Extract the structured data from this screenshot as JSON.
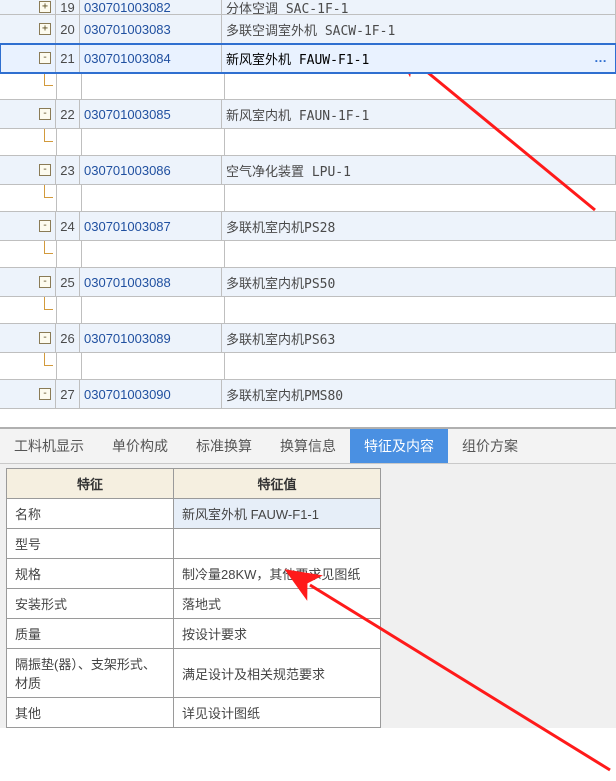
{
  "tree": {
    "rows": [
      {
        "exp": "+",
        "idx": "19",
        "code": "030701003082",
        "desc": "分体空调 SAC-1F-1",
        "spacer_after": false
      },
      {
        "exp": "+",
        "idx": "20",
        "code": "030701003083",
        "desc": "多联空调室外机 SACW-1F-1",
        "spacer_after": false
      },
      {
        "exp": "-",
        "idx": "21",
        "code": "030701003084",
        "desc": "新风室外机 FAUW-F1-1",
        "spacer_after": true,
        "selected": true,
        "ellipsis": "…"
      },
      {
        "exp": "-",
        "idx": "22",
        "code": "030701003085",
        "desc": "新风室内机 FAUN-1F-1",
        "spacer_after": true
      },
      {
        "exp": "-",
        "idx": "23",
        "code": "030701003086",
        "desc": "空气净化装置 LPU-1",
        "spacer_after": true
      },
      {
        "exp": "-",
        "idx": "24",
        "code": "030701003087",
        "desc": "多联机室内机PS28",
        "spacer_after": true
      },
      {
        "exp": "-",
        "idx": "25",
        "code": "030701003088",
        "desc": "多联机室内机PS50",
        "spacer_after": true
      },
      {
        "exp": "-",
        "idx": "26",
        "code": "030701003089",
        "desc": "多联机室内机PS63",
        "spacer_after": true
      },
      {
        "exp": "-",
        "idx": "27",
        "code": "030701003090",
        "desc": "多联机室内机PMS80",
        "spacer_after": false
      }
    ]
  },
  "panel": {
    "tabs": [
      {
        "label": "工料机显示"
      },
      {
        "label": "单价构成"
      },
      {
        "label": "标准换算"
      },
      {
        "label": "换算信息"
      },
      {
        "label": "特征及内容",
        "active": true
      },
      {
        "label": "组价方案"
      }
    ],
    "header": {
      "col1": "特征",
      "col2": "特征值"
    },
    "props": [
      {
        "key": "名称",
        "val": "新风室外机 FAUW-F1-1",
        "hi": true
      },
      {
        "key": "型号",
        "val": ""
      },
      {
        "key": "规格",
        "val": "制冷量28KW，其他要求见图纸"
      },
      {
        "key": "安装形式",
        "val": "落地式"
      },
      {
        "key": "质量",
        "val": "按设计要求"
      },
      {
        "key": "隔振垫(器）、支架形式、材质",
        "val": "满足设计及相关规范要求"
      },
      {
        "key": "其他",
        "val": "详见设计图纸"
      }
    ]
  }
}
